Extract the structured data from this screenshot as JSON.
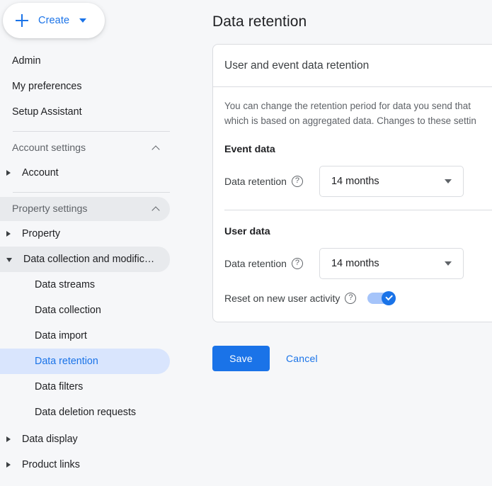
{
  "sidebar": {
    "create_button": {
      "label": "Create",
      "plus_icon": "plus-icon",
      "caret_icon": "caret-down-icon"
    },
    "top_items": [
      {
        "label": "Admin"
      },
      {
        "label": "My preferences"
      },
      {
        "label": "Setup Assistant"
      }
    ],
    "account_settings": {
      "label": "Account settings",
      "chevron_icon": "chevron-up-icon",
      "expanded": true,
      "items": [
        {
          "label": "Account",
          "expander_icon": "triangle-right-icon",
          "expanded": false
        }
      ]
    },
    "property_settings": {
      "label": "Property settings",
      "chevron_icon": "chevron-up-icon",
      "expanded": true,
      "highlighted": true,
      "items": [
        {
          "label": "Property",
          "expander_icon": "triangle-right-icon",
          "expanded": false
        },
        {
          "label": "Data collection and modifica…",
          "expander_icon": "triangle-down-icon",
          "expanded": true,
          "highlighted": true
        },
        {
          "label": "Data display",
          "expander_icon": "triangle-right-icon",
          "expanded": false
        },
        {
          "label": "Product links",
          "expander_icon": "triangle-right-icon",
          "expanded": false
        }
      ],
      "sub_items": [
        {
          "label": "Data streams",
          "selected": false
        },
        {
          "label": "Data collection",
          "selected": false
        },
        {
          "label": "Data import",
          "selected": false
        },
        {
          "label": "Data retention",
          "selected": true
        },
        {
          "label": "Data filters",
          "selected": false
        },
        {
          "label": "Data deletion requests",
          "selected": false
        }
      ]
    }
  },
  "main": {
    "page_title": "Data retention",
    "card": {
      "title": "User and event data retention",
      "description_line1": "You can change the retention period for data you send that",
      "description_line2": "which is based on aggregated data. Changes to these settin",
      "event_data": {
        "group_title": "Event data",
        "field_label": "Data retention",
        "help_icon": "help-circle-icon",
        "select_value": "14 months",
        "select_caret_icon": "caret-down-icon"
      },
      "user_data": {
        "group_title": "User data",
        "field_label": "Data retention",
        "help_icon": "help-circle-icon",
        "select_value": "14 months",
        "select_caret_icon": "caret-down-icon",
        "toggle_label": "Reset on new user activity",
        "toggle_help_icon": "help-circle-icon",
        "toggle_on": true,
        "toggle_icon": "check-icon"
      }
    },
    "actions": {
      "save_label": "Save",
      "cancel_label": "Cancel"
    }
  },
  "colors": {
    "accent": "#1a73e8",
    "selected_nav_bg": "#d9e5fd",
    "section_bg": "#e8eaed",
    "page_bg": "#f6f7f9",
    "card_bg": "#ffffff",
    "border": "#dadce0",
    "toggle_track": "#a5c4fa"
  }
}
